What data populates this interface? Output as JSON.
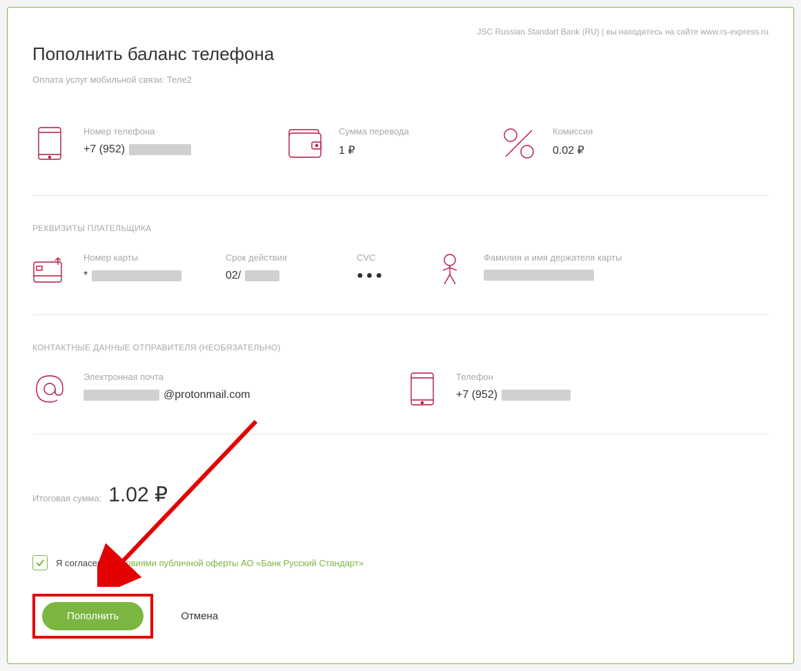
{
  "header": {
    "top_note": "JSC Russian Standart Bank (RU) | вы находитесь на сайте www.rs-express.ru",
    "title": "Пополнить баланс телефона",
    "subtitle": "Оплата услуг мобильной связи: Теле2"
  },
  "summary": {
    "phone_label": "Номер телефона",
    "phone_value_prefix": "+7 (952)",
    "amount_label": "Сумма перевода",
    "amount_value": "1 ₽",
    "commission_label": "Комиссия",
    "commission_value": "0.02 ₽"
  },
  "payer": {
    "section_title": "РЕКВИЗИТЫ ПЛАТЕЛЬЩИКА",
    "card_label": "Номер карты",
    "card_prefix": "*",
    "expiry_label": "Срок действия",
    "expiry_prefix": "02/",
    "cvc_label": "CVC",
    "cvc_value": "●●●",
    "holder_label": "Фамилия и имя держателя карты"
  },
  "contacts": {
    "section_title": "КОНТАКТНЫЕ ДАННЫЕ ОТПРАВИТЕЛЯ (НЕОБЯЗАТЕЛЬНО)",
    "email_label": "Электронная почта",
    "email_suffix": "@protonmail.com",
    "phone_label": "Телефон",
    "phone_prefix": "+7 (952)"
  },
  "total": {
    "label": "Итоговая сумма:",
    "value": "1.02 ₽"
  },
  "agreement": {
    "text_prefix": "Я согласен с ",
    "link_text": "условиями публичной оферты АО «Банк Русский Стандарт»"
  },
  "buttons": {
    "submit": "Пополнить",
    "cancel": "Отмена"
  }
}
